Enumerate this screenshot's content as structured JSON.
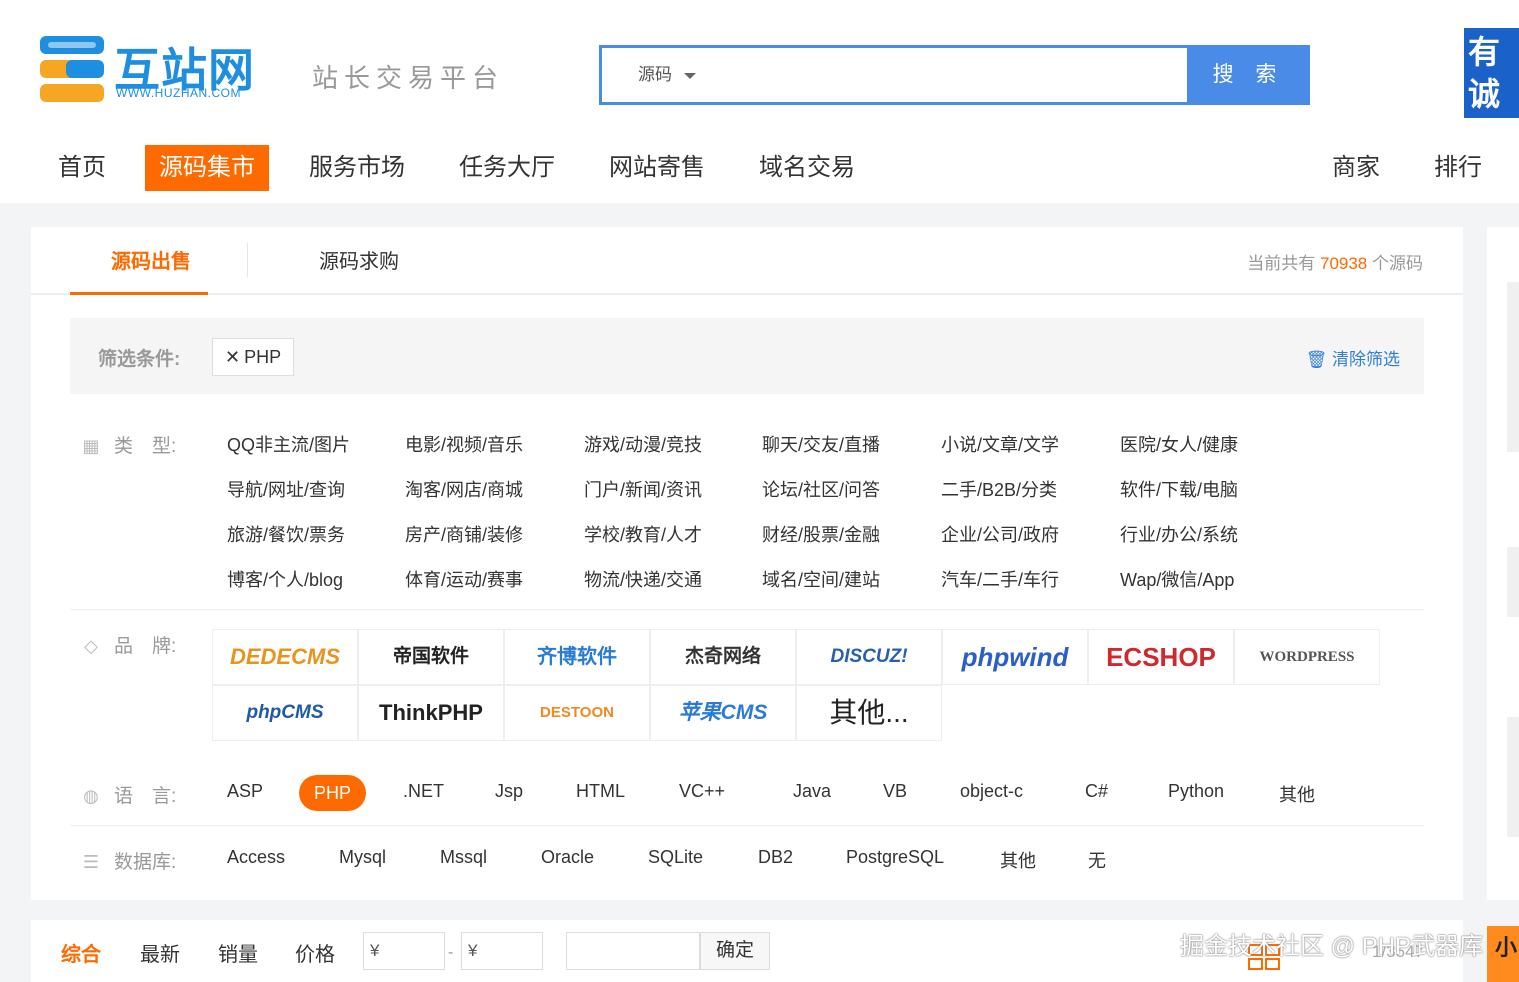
{
  "header": {
    "logo_text": "互站网",
    "logo_url": "WWW.HUZHAN.COM",
    "slogan": "站长交易平台",
    "search_category": "源码",
    "search_button": "搜 索",
    "ad_chars": [
      "有",
      "诚"
    ]
  },
  "nav": {
    "left": [
      "首页",
      "源码集市",
      "服务市场",
      "任务大厅",
      "网站寄售",
      "域名交易"
    ],
    "right": [
      "商家",
      "排行"
    ],
    "active": "源码集市"
  },
  "tabs": {
    "items": [
      "源码出售",
      "源码求购"
    ],
    "active": "源码出售",
    "count_prefix": "当前共有",
    "count": "70938",
    "count_suffix": "个源码"
  },
  "filter": {
    "label": "筛选条件:",
    "tag": "PHP",
    "clear": "清除筛选"
  },
  "type_row": {
    "label": "类　型:",
    "options": [
      [
        "QQ非主流/图片",
        "电影/视频/音乐",
        "游戏/动漫/竞技",
        "聊天/交友/直播",
        "小说/文章/文学",
        "医院/女人/健康"
      ],
      [
        "导航/网址/查询",
        "淘客/网店/商城",
        "门户/新闻/资讯",
        "论坛/社区/问答",
        "二手/B2B/分类",
        "软件/下载/电脑"
      ],
      [
        "旅游/餐饮/票务",
        "房产/商铺/装修",
        "学校/教育/人才",
        "财经/股票/金融",
        "企业/公司/政府",
        "行业/办公/系统"
      ],
      [
        "博客/个人/blog",
        "体育/运动/赛事",
        "物流/快递/交通",
        "域名/空间/建站",
        "汽车/二手/车行",
        "Wap/微信/App"
      ]
    ]
  },
  "brand_row": {
    "label": "品　牌:",
    "brands_row1": [
      "DEDECMS",
      "帝国软件",
      "齐博软件",
      "杰奇网络",
      "DISCUZ!",
      "phpwind",
      "ECSHOP",
      "WORDPRESS"
    ],
    "brands_row2": [
      "phpCMS",
      "ThinkPHP",
      "DESTOON",
      "苹果CMS",
      "其他..."
    ]
  },
  "lang_row": {
    "label": "语　言:",
    "options": [
      "ASP",
      "PHP",
      ".NET",
      "Jsp",
      "HTML",
      "VC++",
      "Java",
      "VB",
      "object-c",
      "C#",
      "Python",
      "其他"
    ],
    "active": "PHP"
  },
  "db_row": {
    "label": "数据库:",
    "options": [
      "Access",
      "Mysql",
      "Mssql",
      "Oracle",
      "SQLite",
      "DB2",
      "PostgreSQL",
      "其他",
      "无"
    ]
  },
  "sortbar": {
    "items": [
      "综合",
      "最新",
      "销量",
      "价格"
    ],
    "active": "综合",
    "price_min": "¥",
    "price_max": "¥",
    "confirm": "确定",
    "page_fragment": "1/3547"
  },
  "watermark": "掘金技术社区 @ PHP武器库",
  "corner_ad": "小",
  "colors": {
    "accent": "#ff6a00",
    "brand_blue": "#4a8be8",
    "link_blue": "#2f7fd8"
  }
}
